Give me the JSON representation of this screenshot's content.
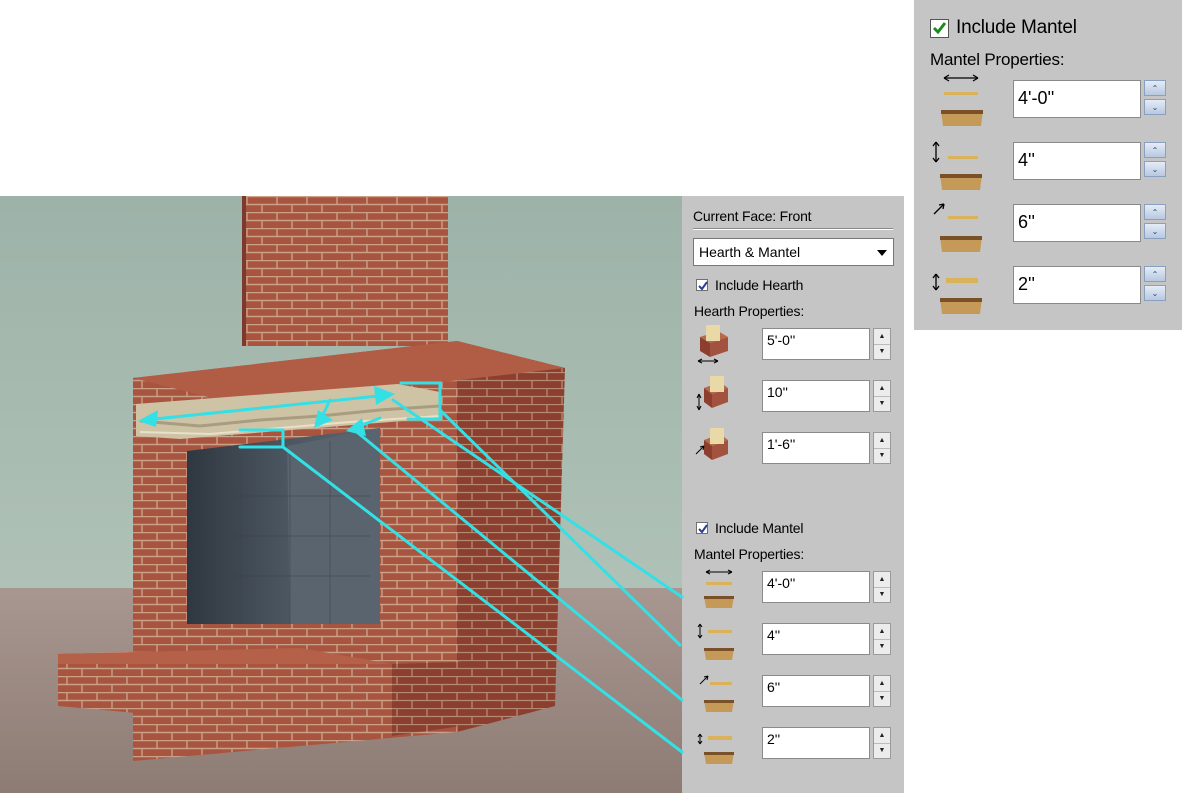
{
  "panel": {
    "current_face_label": "Current Face: Front",
    "type_select_value": "Hearth & Mantel",
    "include_hearth_label": "Include Hearth",
    "include_hearth_checked": true,
    "hearth_properties_label": "Hearth Properties:",
    "hearth_fields": [
      {
        "icon": "hearth-width-icon",
        "value": "5'-0''"
      },
      {
        "icon": "hearth-height-icon",
        "value": "10''"
      },
      {
        "icon": "hearth-depth-icon",
        "value": "1'-6''"
      }
    ],
    "include_mantel_label": "Include Mantel",
    "include_mantel_checked": true,
    "mantel_properties_label": "Mantel Properties:",
    "mantel_fields": [
      {
        "icon": "mantel-width-icon",
        "value": "4'-0''"
      },
      {
        "icon": "mantel-height-icon",
        "value": "4''"
      },
      {
        "icon": "mantel-depth-icon",
        "value": "6''"
      },
      {
        "icon": "mantel-thickness-icon",
        "value": "2''"
      }
    ]
  },
  "zoomed_panel": {
    "include_mantel_label": "Include Mantel",
    "include_mantel_checked": true,
    "mantel_properties_label": "Mantel Properties:",
    "mantel_fields": [
      {
        "icon": "mantel-width-icon",
        "value": "4'-0''"
      },
      {
        "icon": "mantel-height-icon",
        "value": "4''"
      },
      {
        "icon": "mantel-depth-icon",
        "value": "6''"
      },
      {
        "icon": "mantel-thickness-icon",
        "value": "2''"
      }
    ]
  },
  "colors": {
    "panel_bg": "#c5c5c5",
    "annotation": "#33e0e6",
    "brick": "#a35240",
    "wall": "#a2b6ac",
    "floor": "#a08e86",
    "firebox": "#3f4750",
    "checkmark_green": "#1f8a1f",
    "checkmark_blue": "#2b3f8f"
  }
}
